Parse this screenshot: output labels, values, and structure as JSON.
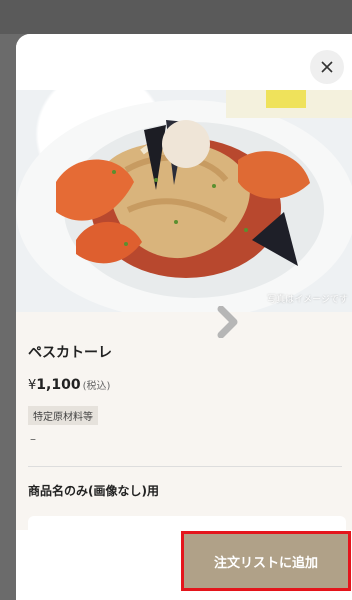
{
  "modal": {
    "close_icon": "close-icon"
  },
  "product": {
    "image_caption": "写真はイメージです",
    "name": "ペスカトーレ",
    "price_symbol": "¥",
    "price": "1,100",
    "tax_note": "(税込)",
    "allergen_label": "特定原材料等",
    "allergen_value": "–"
  },
  "options": {
    "section_title": "商品名のみ(画像なし)用",
    "first_option": "商品名のみ(画像なし)"
  },
  "actions": {
    "add_to_order": "注文リストに追加"
  },
  "colors": {
    "button": "#b0a188",
    "highlight": "#e4151c",
    "background": "#f8f5f1"
  }
}
